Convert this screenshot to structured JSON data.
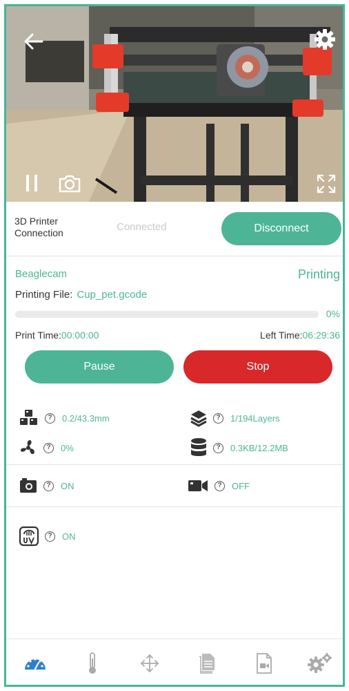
{
  "camera": {
    "back_icon": "arrow-left-icon",
    "settings_icon": "gear-icon",
    "pause_icon": "pause-icon",
    "snapshot_icon": "camera-icon",
    "fullscreen_icon": "fullscreen-icon"
  },
  "connection": {
    "label": "3D Printer Connection",
    "status": "Connected",
    "button_label": "Disconnect"
  },
  "printing": {
    "camera_name": "Beaglecam",
    "state": "Printing",
    "file_label": "Printing File:",
    "file_name": "Cup_pet.gcode",
    "progress": 0,
    "progress_text": "0%",
    "print_time_label": "Print Time:",
    "print_time_value": "00:00:00",
    "left_time_label": "Left Time:",
    "left_time_value": "06:29:36",
    "pause_label": "Pause",
    "stop_label": "Stop"
  },
  "stats": {
    "height": "0.2/43.3mm",
    "layers": "1/194Layers",
    "fan": "0%",
    "data": "0.3KB/12.2MB"
  },
  "toggles": {
    "photo_status": "ON",
    "video_status": "OFF",
    "uv_status": "ON"
  },
  "tabbar": {
    "items": [
      "dashboard-icon",
      "thermometer-icon",
      "move-icon",
      "files-icon",
      "video-file-icon",
      "settings-icon"
    ]
  },
  "colors": {
    "accent": "#4db596",
    "stop": "#d8282a",
    "frame": "#46b59a",
    "active_tab": "#2f7fd1"
  }
}
